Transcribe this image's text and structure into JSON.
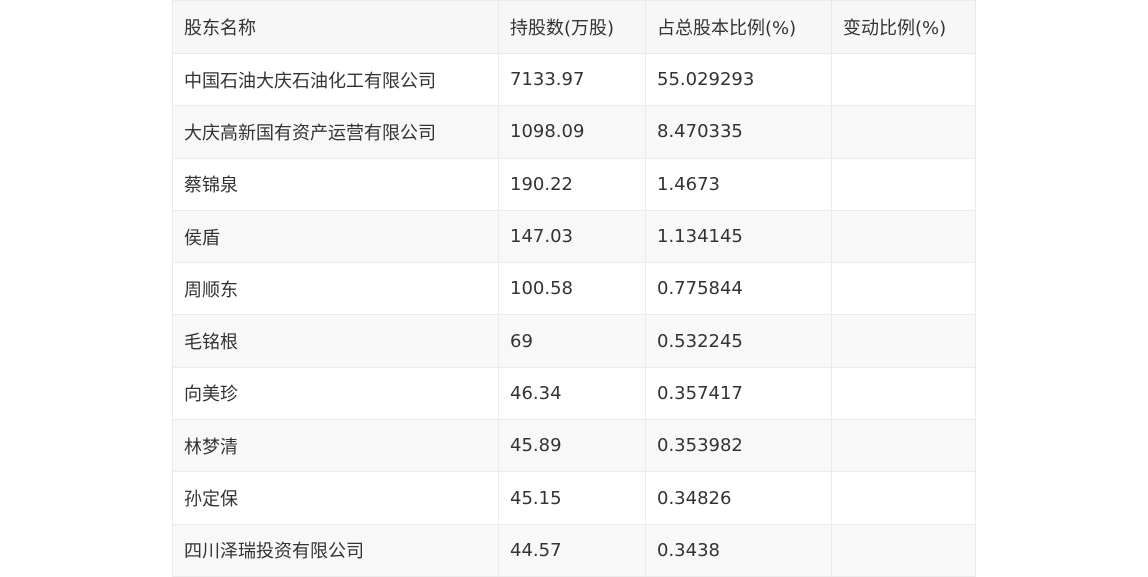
{
  "table": {
    "headers": [
      "股东名称",
      "持股数(万股)",
      "占总股本比例(%)",
      "变动比例(%)"
    ],
    "rows": [
      [
        "中国石油大庆石油化工有限公司",
        "7133.97",
        "55.029293",
        ""
      ],
      [
        "大庆高新国有资产运营有限公司",
        "1098.09",
        "8.470335",
        ""
      ],
      [
        "蔡锦泉",
        "190.22",
        "1.4673",
        ""
      ],
      [
        "侯盾",
        "147.03",
        "1.134145",
        ""
      ],
      [
        "周顺东",
        "100.58",
        "0.775844",
        ""
      ],
      [
        "毛铭根",
        "69",
        "0.532245",
        ""
      ],
      [
        "向美珍",
        "46.34",
        "0.357417",
        ""
      ],
      [
        "林梦清",
        "45.89",
        "0.353982",
        ""
      ],
      [
        "孙定保",
        "45.15",
        "0.34826",
        ""
      ],
      [
        "四川泽瑞投资有限公司",
        "44.57",
        "0.3438",
        ""
      ]
    ]
  }
}
